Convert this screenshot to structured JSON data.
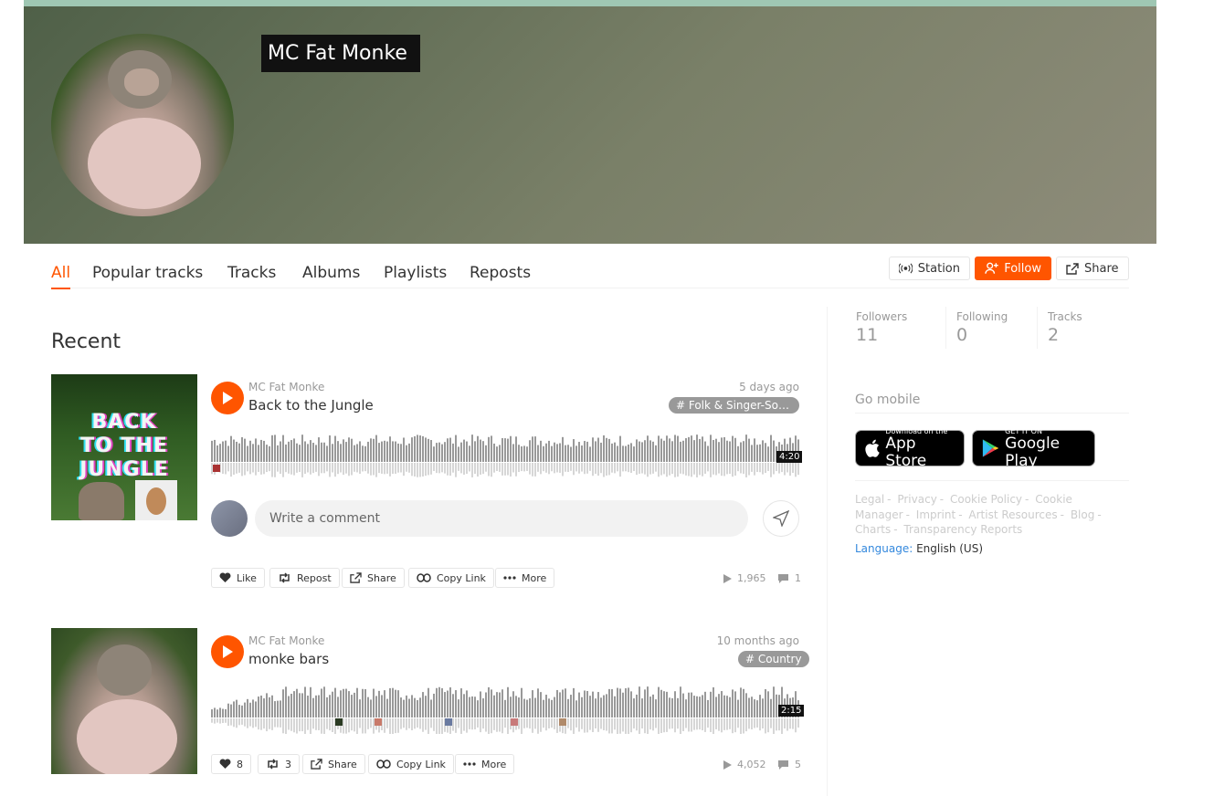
{
  "profile": {
    "name": "MC Fat Monke"
  },
  "tabs": [
    "All",
    "Popular tracks",
    "Tracks",
    "Albums",
    "Playlists",
    "Reposts"
  ],
  "actions": {
    "station": "Station",
    "follow": "Follow",
    "share": "Share"
  },
  "section_title": "Recent",
  "tracks": [
    {
      "artist": "MC Fat Monke",
      "title": "Back to the Jungle",
      "posted": "5 days ago",
      "tag": "# Folk & Singer-Song...",
      "duration": "4:20",
      "artwork_text": [
        "BACK",
        "TO THE",
        "JUNGLE"
      ],
      "buttons": {
        "like": "Like",
        "repost": "Repost",
        "share": "Share",
        "copy": "Copy Link",
        "more": "More"
      },
      "plays": "1,965",
      "comments": "1"
    },
    {
      "artist": "MC Fat Monke",
      "title": "monke bars",
      "posted": "10 months ago",
      "tag": "# Country",
      "duration": "2:15",
      "buttons": {
        "like": "8",
        "repost": "3",
        "share": "Share",
        "copy": "Copy Link",
        "more": "More"
      },
      "plays": "4,052",
      "comments": "5"
    }
  ],
  "comment": {
    "placeholder": "Write a comment"
  },
  "sidebar": {
    "stats": [
      {
        "label": "Followers",
        "value": "11"
      },
      {
        "label": "Following",
        "value": "0"
      },
      {
        "label": "Tracks",
        "value": "2"
      }
    ],
    "go_mobile": "Go mobile",
    "app_store": {
      "small": "Download on the",
      "big": "App Store"
    },
    "google_play": {
      "small": "GET IT ON",
      "big": "Google Play"
    },
    "footer_links": [
      "Legal",
      "Privacy",
      "Cookie Policy",
      "Cookie Manager",
      "Imprint",
      "Artist Resources",
      "Blog",
      "Charts",
      "Transparency Reports"
    ],
    "language_label": "Language:",
    "language_value": "English (US)"
  },
  "colors": {
    "accent": "#ff5500",
    "muted": "#999999",
    "wave": "#cccccc"
  }
}
